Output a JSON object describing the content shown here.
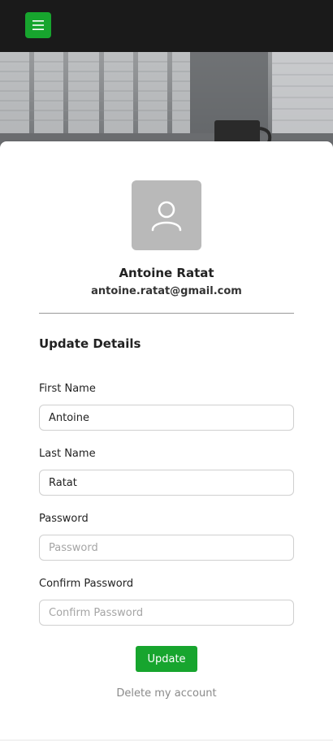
{
  "header": {
    "menu_icon": "hamburger-menu-icon",
    "accent_color": "#17a52e"
  },
  "profile": {
    "avatar_icon": "user-icon",
    "name": "Antoine Ratat",
    "email": "antoine.ratat@gmail.com"
  },
  "form": {
    "title": "Update Details",
    "first_name": {
      "label": "First Name",
      "value": "Antoine"
    },
    "last_name": {
      "label": "Last Name",
      "value": "Ratat"
    },
    "password": {
      "label": "Password",
      "value": "",
      "placeholder": "Password"
    },
    "confirm_password": {
      "label": "Confirm Password",
      "value": "",
      "placeholder": "Confirm Password"
    },
    "submit_label": "Update",
    "delete_label": "Delete my account"
  }
}
